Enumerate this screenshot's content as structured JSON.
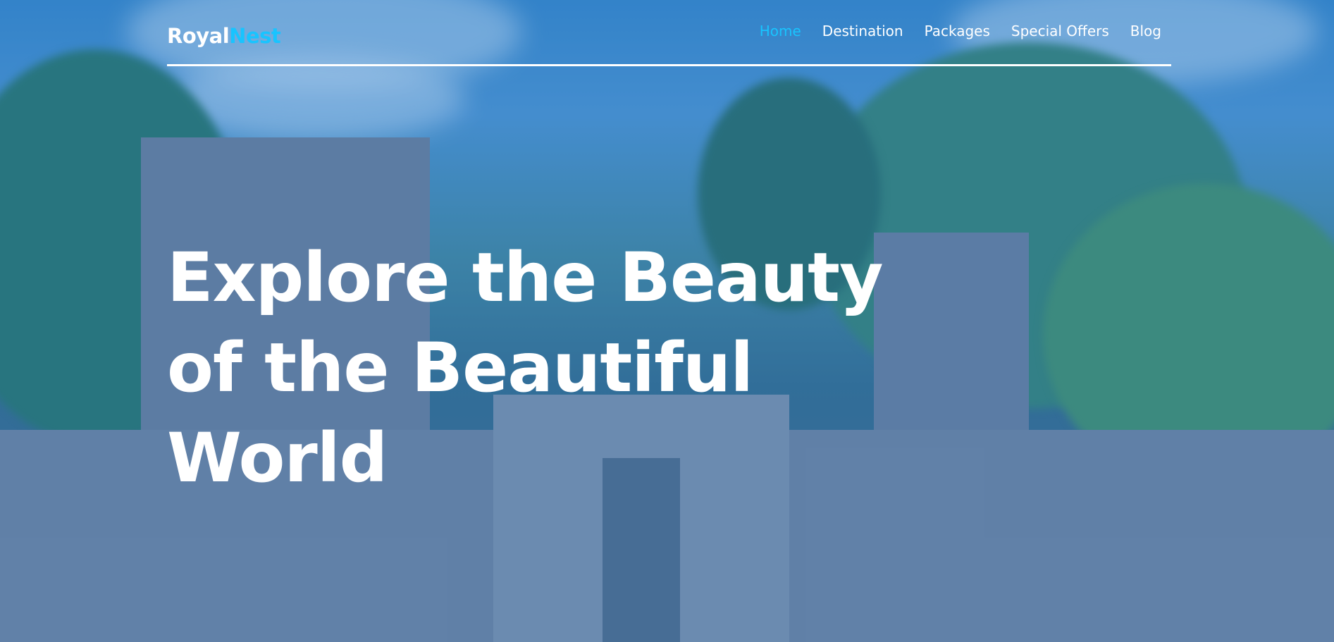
{
  "brand": {
    "name_part1": "Royal",
    "name_part2": "Nest",
    "accent_color": "#18c4ff"
  },
  "nav": {
    "items": [
      {
        "label": "Home",
        "active": true
      },
      {
        "label": "Destination",
        "active": false
      },
      {
        "label": "Packages",
        "active": false
      },
      {
        "label": "Special Offers",
        "active": false
      },
      {
        "label": "Blog",
        "active": false
      }
    ]
  },
  "hero": {
    "line1": "Explore the Beauty",
    "line2": "of the Beautiful",
    "line3": "World",
    "background": "temple ruins with trees under blue sky, blue overlay"
  }
}
